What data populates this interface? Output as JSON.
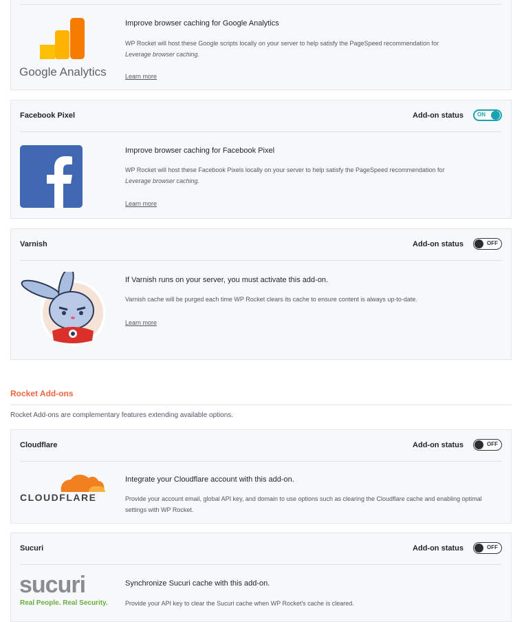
{
  "google_analytics": {
    "logo_text": "Google Analytics",
    "feature_title": "Improve browser caching for Google Analytics",
    "description_line1": "WP Rocket will host these Google scripts locally on your server to help satisfy the PageSpeed recommendation for",
    "description_italic": "Leverage browser caching.",
    "learn_more": "Learn more"
  },
  "facebook_pixel": {
    "title": "Facebook Pixel",
    "status_label": "Add-on status",
    "toggle_text": "ON",
    "toggle_state": "on",
    "feature_title": "Improve browser caching for Facebook Pixel",
    "description_line1": "WP Rocket will host these Facebook Pixels locally on your server to help satisfy the PageSpeed recommendation for",
    "description_italic": "Leverage browser caching.",
    "learn_more": "Learn more"
  },
  "varnish": {
    "title": "Varnish",
    "status_label": "Add-on status",
    "toggle_text": "OFF",
    "toggle_state": "off",
    "feature_title": "If Varnish runs on your server, you must activate this add-on.",
    "description": "Varnish cache will be purged each time WP Rocket clears its cache to ensure content is always up-to-date.",
    "learn_more": "Learn more"
  },
  "rocket_addons": {
    "section_title": "Rocket Add-ons",
    "section_description": "Rocket Add-ons are complementary features extending available options."
  },
  "cloudflare": {
    "title": "Cloudflare",
    "status_label": "Add-on status",
    "toggle_text": "OFF",
    "toggle_state": "off",
    "logo_text": "CLOUDFLARE",
    "feature_title": "Integrate your Cloudflare account with this add-on.",
    "description": "Provide your account email, global API key, and domain to use options such as clearing the Cloudflare cache and enabling optimal settings with WP Rocket."
  },
  "sucuri": {
    "title": "Sucuri",
    "status_label": "Add-on status",
    "toggle_text": "OFF",
    "toggle_state": "off",
    "logo_text": "sucuri",
    "logo_tagline": "Real People. Real Security.",
    "feature_title": "Synchronize Sucuri cache with this add-on.",
    "description": "Provide your API key to clear the Sucuri cache when WP Rocket's cache is cleared."
  },
  "colors": {
    "accent": "#f56640",
    "toggle_on": "#19a3b2",
    "facebook_blue": "#4267b2",
    "cloudflare_orange": "#f38020",
    "sucuri_green": "#6cae3e"
  }
}
